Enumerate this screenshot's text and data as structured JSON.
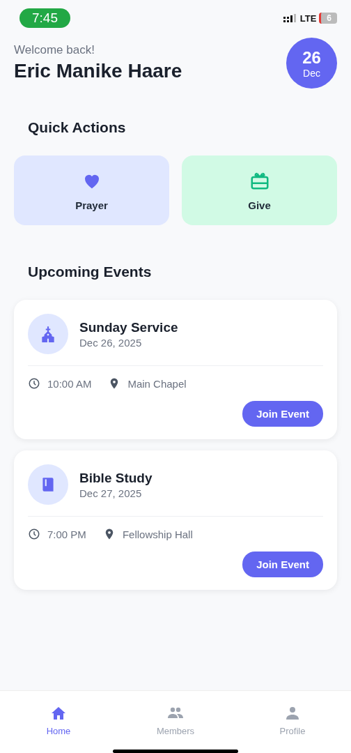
{
  "status_bar": {
    "time": "7:45",
    "network": "LTE",
    "battery": "6"
  },
  "header": {
    "greeting": "Welcome back!",
    "name": "Eric Manike Haare",
    "date_day": "26",
    "date_month": "Dec"
  },
  "quick_actions": {
    "title": "Quick Actions",
    "items": [
      {
        "kind": "heart",
        "label": "Prayer"
      },
      {
        "kind": "gift",
        "label": "Give"
      }
    ]
  },
  "events": {
    "title": "Upcoming Events",
    "items": [
      {
        "kind": "church",
        "title": "Sunday Service",
        "date": "Dec 26, 2025",
        "time": "10:00 AM",
        "location": "Main Chapel",
        "button": "Join Event"
      },
      {
        "kind": "book",
        "title": "Bible Study",
        "date": "Dec 27, 2025",
        "time": "7:00 PM",
        "location": "Fellowship Hall",
        "button": "Join Event"
      }
    ]
  },
  "nav": [
    {
      "kind": "home",
      "label": "Home",
      "selected": true
    },
    {
      "kind": "members",
      "label": "Members",
      "selected": false
    },
    {
      "kind": "profile",
      "label": "Profile",
      "selected": false
    }
  ]
}
